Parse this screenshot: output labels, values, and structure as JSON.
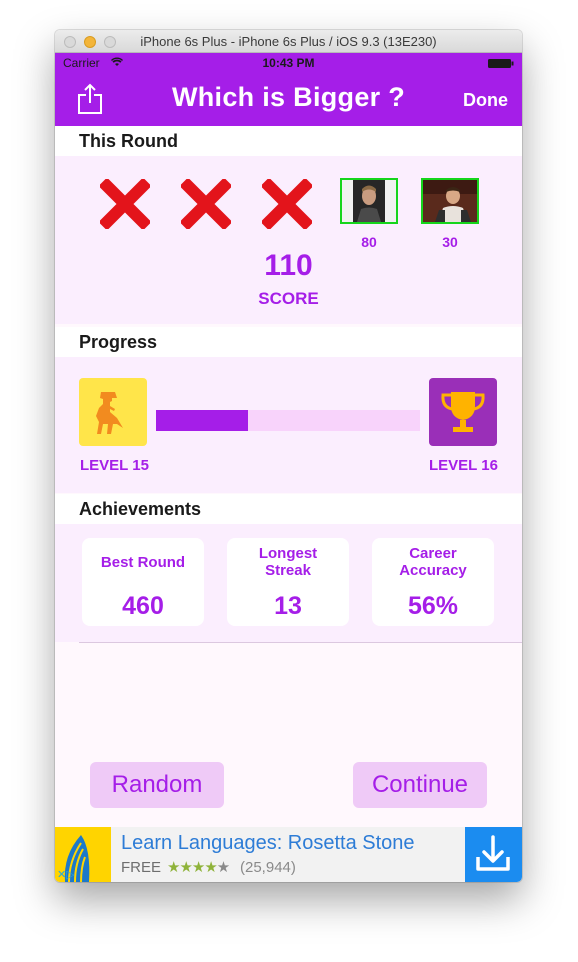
{
  "window": {
    "title": "iPhone 6s Plus - iPhone 6s Plus / iOS 9.3 (13E230)"
  },
  "status_bar": {
    "carrier": "Carrier",
    "time": "10:43 PM"
  },
  "nav": {
    "title": "Which is Bigger ?",
    "done_label": "Done"
  },
  "this_round": {
    "header": "This Round",
    "misses": 3,
    "hits": [
      {
        "value": "80"
      },
      {
        "value": "30"
      }
    ],
    "score_value": "110",
    "score_label": "SCORE"
  },
  "progress": {
    "header": "Progress",
    "from_level": "LEVEL 15",
    "to_level": "LEVEL 16",
    "fraction": 0.35
  },
  "achievements": {
    "header": "Achievements",
    "cards": [
      {
        "title": "Best Round",
        "value": "460"
      },
      {
        "title": "Longest Streak",
        "value": "13"
      },
      {
        "title": "Career Accuracy",
        "value": "56%"
      }
    ]
  },
  "buttons": {
    "random_label": "Random",
    "continue_label": "Continue"
  },
  "ad": {
    "title": "Learn Languages: Rosetta Stone",
    "price": "FREE",
    "stars": "★★★★★",
    "rating_count": "(25,944)",
    "choices": "✕▷"
  },
  "colors": {
    "accent": "#a51ee8",
    "hit_border": "#15d51b",
    "miss_red": "#e3141b",
    "progress_track": "#f8d3fb",
    "level_from_tile": "#ffe54a",
    "level_to_tile": "#9a2fb8",
    "ad_link": "#2d7cd6"
  }
}
